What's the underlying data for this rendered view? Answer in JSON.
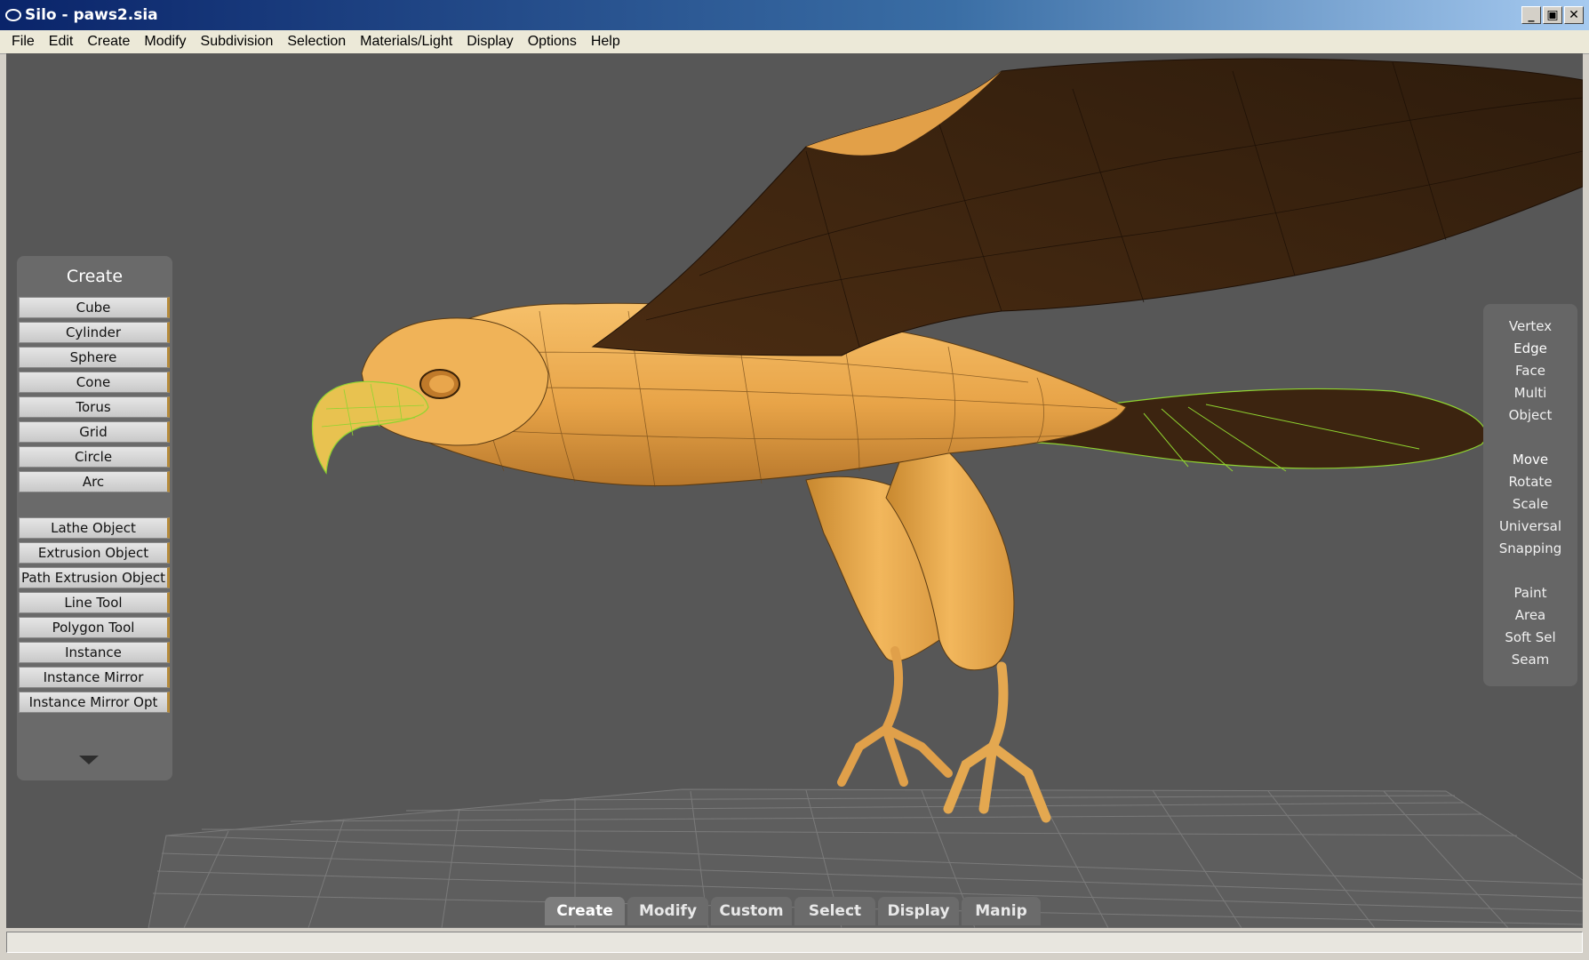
{
  "window": {
    "title": "Silo  - paws2.sia",
    "controls": {
      "minimize": "_",
      "restore": "▣",
      "close": "✕"
    }
  },
  "menu": [
    "File",
    "Edit",
    "Create",
    "Modify",
    "Subdivision",
    "Selection",
    "Materials/Light",
    "Display",
    "Options",
    "Help"
  ],
  "create_panel": {
    "title": "Create",
    "primitives": [
      "Cube",
      "Cylinder",
      "Sphere",
      "Cone",
      "Torus",
      "Grid",
      "Circle",
      "Arc"
    ],
    "tools": [
      "Lathe Object",
      "Extrusion Object",
      "Path Extrusion Object",
      "Line Tool",
      "Polygon Tool",
      "Instance",
      "Instance Mirror",
      "Instance Mirror Opt"
    ],
    "more_icon": "chevron-down-icon"
  },
  "selection_panel": {
    "modes": [
      "Vertex",
      "Edge",
      "Face",
      "Multi",
      "Object"
    ],
    "manipulators": [
      "Move",
      "Rotate",
      "Scale",
      "Universal",
      "Snapping"
    ],
    "selection_tools": [
      "Paint",
      "Area",
      "Soft Sel",
      "Seam"
    ]
  },
  "bottom_tabs": [
    "Create",
    "Modify",
    "Custom",
    "Select",
    "Display",
    "Manip"
  ],
  "active_tab": "Create",
  "colors": {
    "viewport_bg": "#575757",
    "model_body": "#e8a448",
    "wing_dark": "#3c2410",
    "selection_edges": "#8fd430",
    "grid": "#8a8a8a"
  }
}
